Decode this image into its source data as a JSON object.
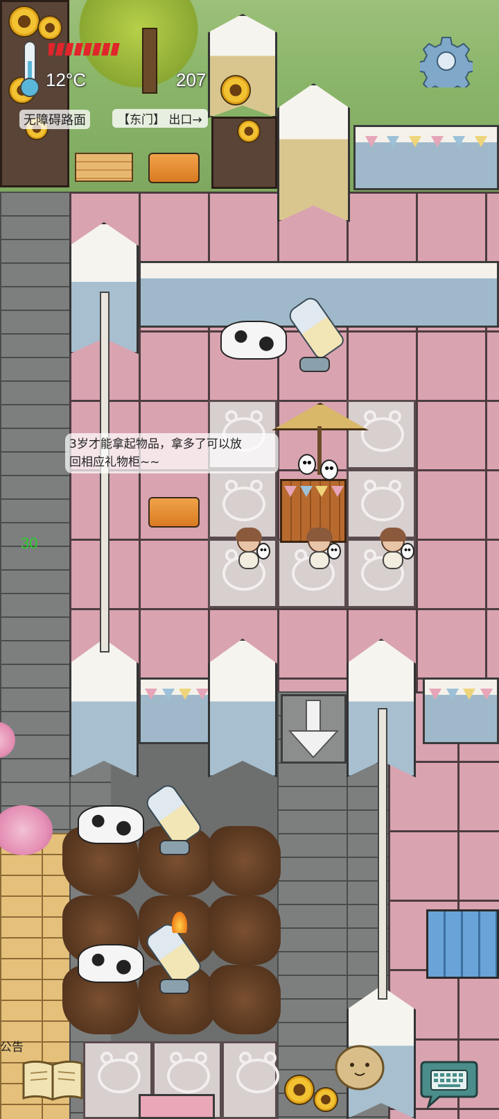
{
  "hud": {
    "temperature": "12°C",
    "counter": "207",
    "road_label": "无障碍路面",
    "sign_label": "【东门】 出口→",
    "side_number": "30",
    "notice_label": "公告"
  },
  "dialogue": {
    "line1": "3岁才能拿起物品，拿多了可以放",
    "line2": "回相应礼物柜~~"
  },
  "icons": {
    "settings": "gear-icon",
    "thermometer": "thermometer-icon",
    "health_bar": "health-bar-icon",
    "book": "book-icon",
    "keyboard": "keyboard-icon",
    "emote": "potato-face-icon",
    "arrow_down": "arrow-down-icon"
  },
  "colors": {
    "health_bar": "#e0252b",
    "side_number": "#29d129",
    "pink_floor": "#d9a3b0",
    "blue_wall": "#9fb9ca",
    "speech_button": "#4a8d8a"
  },
  "health": {
    "segments_filled": 8,
    "segments_total": 8
  }
}
